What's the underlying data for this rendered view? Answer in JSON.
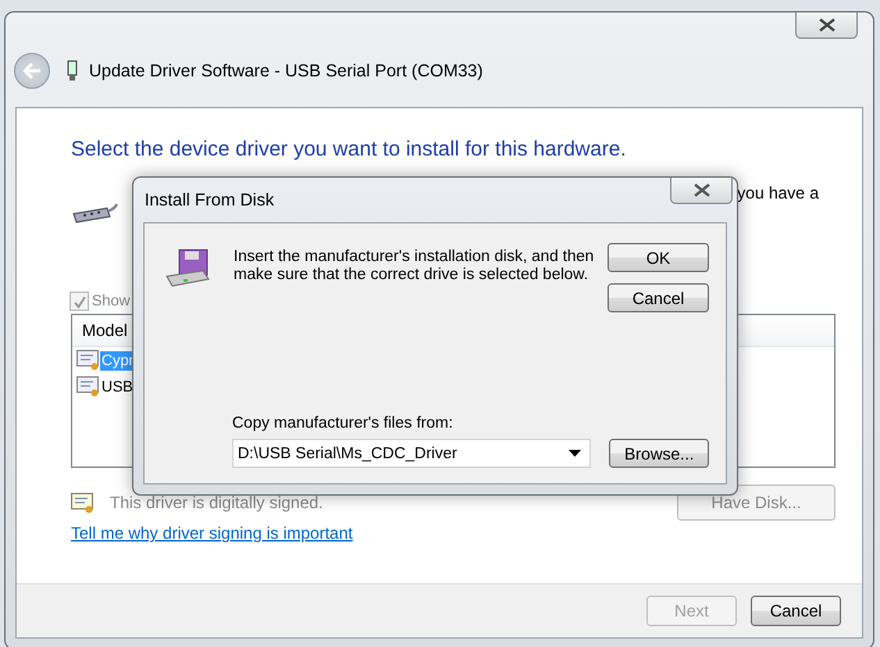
{
  "wizard": {
    "title": "Update Driver Software - USB Serial Port (COM33)",
    "heading": "Select the device driver you want to install for this hardware.",
    "description_tail": "you have a",
    "show_compatible": {
      "label": "Show",
      "checked": true,
      "disabled": true
    },
    "driver_list": {
      "column": "Model",
      "rows": [
        {
          "label": "Cypr",
          "selected": true
        },
        {
          "label": "USB",
          "selected": false
        }
      ]
    },
    "signature_status": "This driver is digitally signed.",
    "have_disk_button": "Have Disk...",
    "signing_link": "Tell me why driver signing is important",
    "buttons": [
      {
        "label": "Next",
        "disabled": true
      },
      {
        "label": "Cancel",
        "disabled": false
      }
    ]
  },
  "dialog": {
    "title": "Install From Disk",
    "message": "Insert the manufacturer's installation disk, and then make sure that the correct drive is selected below.",
    "buttons": [
      "OK",
      "Cancel"
    ],
    "copy_label": "Copy manufacturer's files from:",
    "path": "D:\\USB Serial\\Ms_CDC_Driver",
    "browse_button": "Browse..."
  }
}
